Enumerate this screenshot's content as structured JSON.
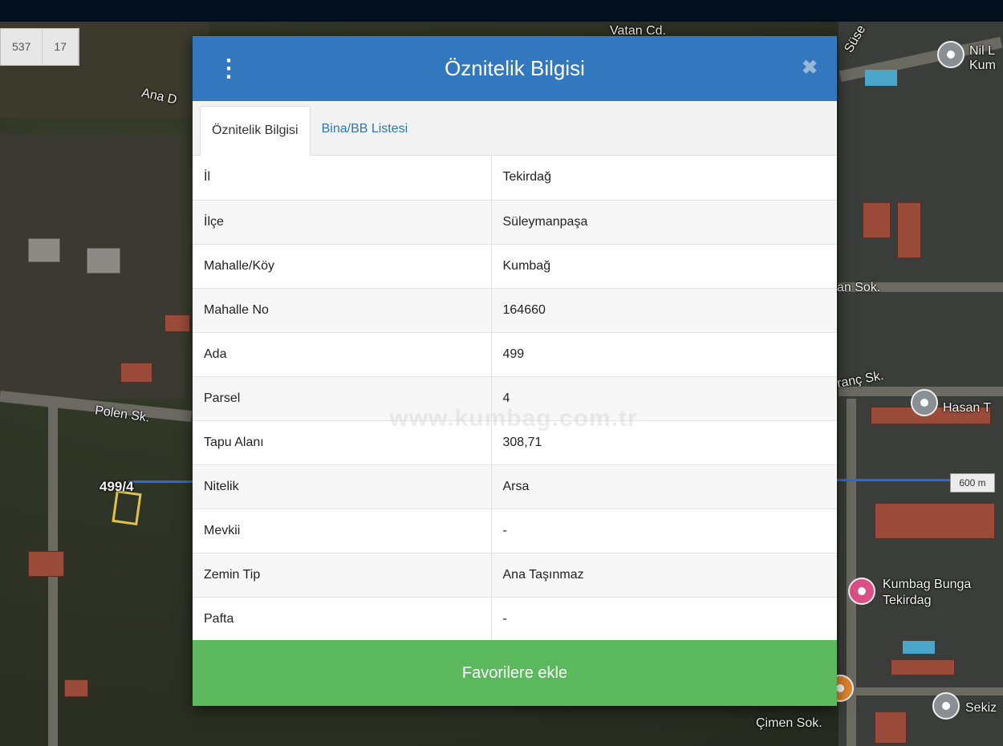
{
  "map": {
    "coords": [
      "537",
      "17"
    ],
    "labels": {
      "ana_road": "Ana D",
      "vatan": "Vatan Cd.",
      "sus": "Süse",
      "polen": "Polen Sk.",
      "parcel": "499/4",
      "an_sok": "an Sok.",
      "anc_sk": "ranç Sk.",
      "cimen": "Çimen Sok.",
      "nil": "Nil L",
      "kum": "Kum",
      "hasan": "Hasan T",
      "kumbag": "Kumbag Bunga",
      "tekirdag": "Tekirdag",
      "sekiz": "Sekiz"
    },
    "scale": "600 m",
    "icons": [
      "place-pin-icon",
      "hotel-pin-icon",
      "restaurant-pin-icon"
    ]
  },
  "modal": {
    "title": "Öznitelik Bilgisi",
    "tabs": [
      "Öznitelik Bilgisi",
      "Bina/BB Listesi"
    ],
    "rows": [
      {
        "key": "İl",
        "value": "Tekirdağ"
      },
      {
        "key": "İlçe",
        "value": "Süleymanpaşa"
      },
      {
        "key": "Mahalle/Köy",
        "value": "Kumbağ"
      },
      {
        "key": "Mahalle No",
        "value": "164660"
      },
      {
        "key": "Ada",
        "value": "499"
      },
      {
        "key": "Parsel",
        "value": "4"
      },
      {
        "key": "Tapu Alanı",
        "value": "308,71"
      },
      {
        "key": "Nitelik",
        "value": "Arsa"
      },
      {
        "key": "Mevkii",
        "value": "-"
      },
      {
        "key": "Zemin Tip",
        "value": "Ana Taşınmaz"
      },
      {
        "key": "Pafta",
        "value": "-"
      }
    ],
    "watermark": "www.kumbag.com.tr",
    "button_label": "Favorilere ekle",
    "colors": {
      "header": "#3378be",
      "button": "#5cb85c",
      "link": "#2f74b8"
    }
  }
}
